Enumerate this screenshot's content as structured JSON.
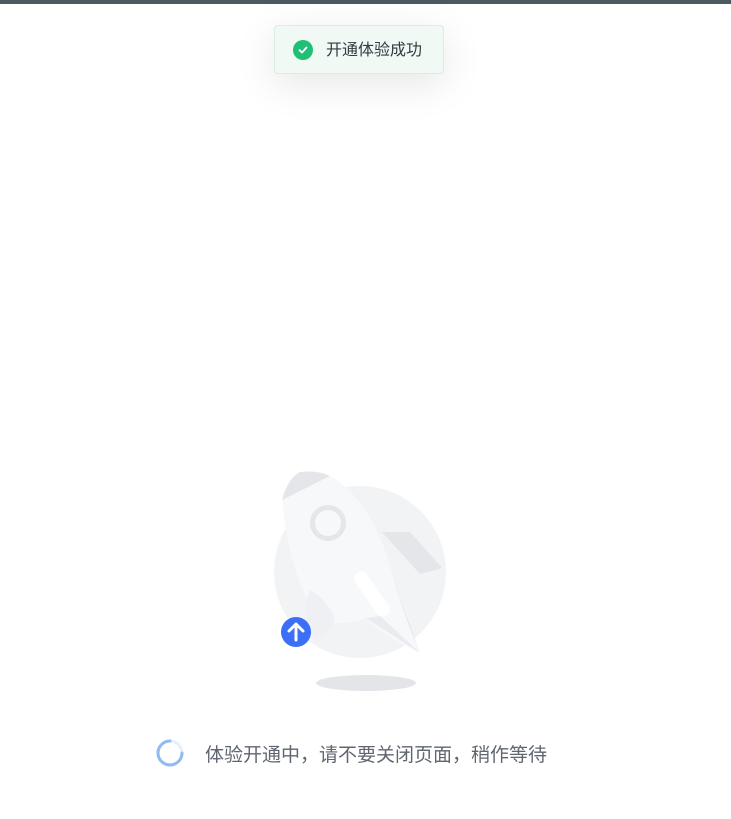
{
  "toast": {
    "message": "开通体验成功",
    "icon": "check-circle-icon",
    "color": "#1fbf75"
  },
  "illustration": {
    "icon": "rocket-icon",
    "badge_icon": "arrow-up-icon",
    "badge_color": "#3b6ff5"
  },
  "status": {
    "spinner_icon": "loading-spinner-icon",
    "text": "体验开通中，请不要关闭页面，稍作等待"
  }
}
